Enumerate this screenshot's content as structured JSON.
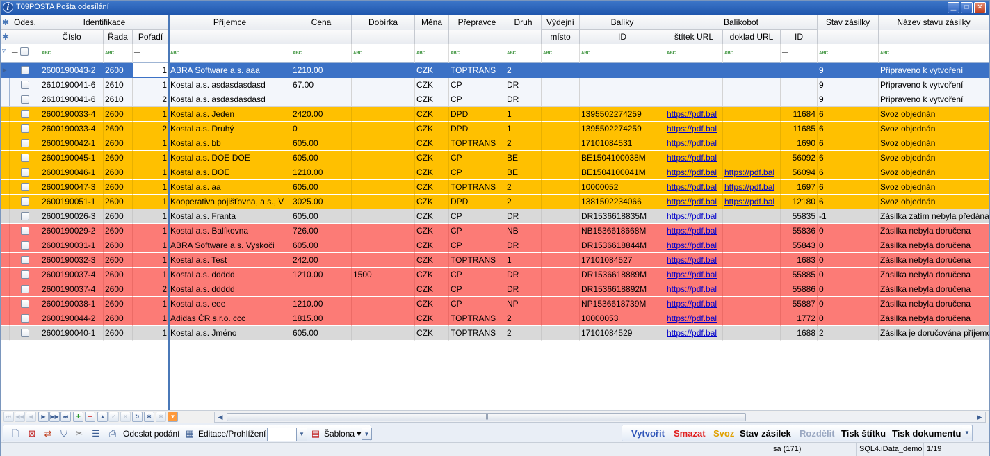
{
  "window": {
    "title": "T09POSTA Pošta odesílání"
  },
  "header": {
    "top": {
      "ods": "Odes.",
      "identifikace": "Identifikace",
      "prijemce": "Příjemce",
      "cena": "Cena",
      "dobirka": "Dobírka",
      "mena": "Měna",
      "prepravce": "Přepravce",
      "druh": "Druh",
      "vydejni": "Výdejní",
      "baliky": "Balíky",
      "balikobot": "Balíkobot",
      "stav": "Stav zásilky",
      "nazev": "Název stavu zásilky"
    },
    "sub": {
      "cislo": "Číslo",
      "rada": "Řada",
      "poradi": "Pořadí",
      "misto": "místo",
      "id": "ID",
      "stitek": "štítek URL",
      "doklad": "doklad URL",
      "bid": "ID"
    }
  },
  "colors": {
    "selected": "#3c72c6",
    "orange": "#ffc000",
    "red": "#fc7b76",
    "gray": "#d9d9d9",
    "white": "#f3f6fb"
  },
  "rows": [
    {
      "style": "sel",
      "cislo": "2600190043-2",
      "rada": "2600",
      "poradi": "1",
      "prijemce": "ABRA Software a.s.  aaa",
      "cena": "1210.00",
      "dobirka": "",
      "mena": "CZK",
      "prepravce": "TOPTRANS",
      "druh": "2",
      "misto": "",
      "id": "",
      "stitek": "",
      "doklad": "",
      "bid": "",
      "stav": "9",
      "nazev": "Připraveno k vytvoření"
    },
    {
      "style": "white",
      "cislo": "2610190041-6",
      "rada": "2610",
      "poradi": "1",
      "prijemce": "Kostal a.s.  asdasdasdasd",
      "cena": "67.00",
      "dobirka": "",
      "mena": "CZK",
      "prepravce": "CP",
      "druh": "DR",
      "misto": "",
      "id": "",
      "stitek": "",
      "doklad": "",
      "bid": "",
      "stav": "9",
      "nazev": "Připraveno k vytvoření"
    },
    {
      "style": "white",
      "cislo": "2610190041-6",
      "rada": "2610",
      "poradi": "2",
      "prijemce": "Kostal a.s.  asdasdasdasd",
      "cena": "",
      "dobirka": "",
      "mena": "CZK",
      "prepravce": "CP",
      "druh": "DR",
      "misto": "",
      "id": "",
      "stitek": "",
      "doklad": "",
      "bid": "",
      "stav": "9",
      "nazev": "Připraveno k vytvoření"
    },
    {
      "style": "orange",
      "cislo": "2600190033-4",
      "rada": "2600",
      "poradi": "1",
      "prijemce": "Kostal a.s.  Jeden",
      "cena": "2420.00",
      "dobirka": "",
      "mena": "CZK",
      "prepravce": "DPD",
      "druh": "1",
      "misto": "",
      "id": "1395502274259",
      "stitek": "https://pdf.bal",
      "doklad": "",
      "bid": "11684",
      "stav": "6",
      "nazev": "Svoz objednán"
    },
    {
      "style": "orange",
      "cislo": "2600190033-4",
      "rada": "2600",
      "poradi": "2",
      "prijemce": "Kostal a.s.  Druhý",
      "cena": "0",
      "dobirka": "",
      "mena": "CZK",
      "prepravce": "DPD",
      "druh": "1",
      "misto": "",
      "id": "1395502274259",
      "stitek": "https://pdf.bal",
      "doklad": "",
      "bid": "11685",
      "stav": "6",
      "nazev": "Svoz objednán"
    },
    {
      "style": "orange",
      "cislo": "2600190042-1",
      "rada": "2600",
      "poradi": "1",
      "prijemce": "Kostal a.s.  bb",
      "cena": "605.00",
      "dobirka": "",
      "mena": "CZK",
      "prepravce": "TOPTRANS",
      "druh": "2",
      "misto": "",
      "id": "17101084531",
      "stitek": "https://pdf.bal",
      "doklad": "",
      "bid": "1690",
      "stav": "6",
      "nazev": "Svoz objednán"
    },
    {
      "style": "orange",
      "cislo": "2600190045-1",
      "rada": "2600",
      "poradi": "1",
      "prijemce": "Kostal a.s.  DOE DOE",
      "cena": "605.00",
      "dobirka": "",
      "mena": "CZK",
      "prepravce": "CP",
      "druh": "BE",
      "misto": "",
      "id": "BE1504100038M",
      "stitek": "https://pdf.bal",
      "doklad": "",
      "bid": "56092",
      "stav": "6",
      "nazev": "Svoz objednán"
    },
    {
      "style": "orange",
      "cislo": "2600190046-1",
      "rada": "2600",
      "poradi": "1",
      "prijemce": "Kostal a.s.  DOE",
      "cena": "1210.00",
      "dobirka": "",
      "mena": "CZK",
      "prepravce": "CP",
      "druh": "BE",
      "misto": "",
      "id": "BE1504100041M",
      "stitek": "https://pdf.bal",
      "doklad": "https://pdf.bal",
      "bid": "56094",
      "stav": "6",
      "nazev": "Svoz objednán"
    },
    {
      "style": "orange",
      "cislo": "2600190047-3",
      "rada": "2600",
      "poradi": "1",
      "prijemce": "Kostal a.s.  aa",
      "cena": "605.00",
      "dobirka": "",
      "mena": "CZK",
      "prepravce": "TOPTRANS",
      "druh": "2",
      "misto": "",
      "id": "10000052",
      "stitek": "https://pdf.bal",
      "doklad": "https://pdf.bal",
      "bid": "1697",
      "stav": "6",
      "nazev": "Svoz objednán"
    },
    {
      "style": "orange",
      "cislo": "2600190051-1",
      "rada": "2600",
      "poradi": "1",
      "prijemce": "Kooperativa pojišťovna, a.s., V",
      "cena": "3025.00",
      "dobirka": "",
      "mena": "CZK",
      "prepravce": "DPD",
      "druh": "2",
      "misto": "",
      "id": "1381502234066",
      "stitek": "https://pdf.bal",
      "doklad": "https://pdf.bal",
      "bid": "12180",
      "stav": "6",
      "nazev": "Svoz objednán"
    },
    {
      "style": "gray",
      "cislo": "2600190026-3",
      "rada": "2600",
      "poradi": "1",
      "prijemce": "Kostal a.s.  Franta",
      "cena": "605.00",
      "dobirka": "",
      "mena": "CZK",
      "prepravce": "CP",
      "druh": "DR",
      "misto": "",
      "id": "DR1536618835M",
      "stitek": "https://pdf.bal",
      "doklad": "",
      "bid": "55835",
      "stav": "-1",
      "nazev": "Zásilka zatím nebyla předána"
    },
    {
      "style": "red",
      "cislo": "2600190029-2",
      "rada": "2600",
      "poradi": "1",
      "prijemce": "Kostal a.s.  Balíkovna",
      "cena": "726.00",
      "dobirka": "",
      "mena": "CZK",
      "prepravce": "CP",
      "druh": "NB",
      "misto": "",
      "id": "NB1536618668M",
      "stitek": "https://pdf.bal",
      "doklad": "",
      "bid": "55836",
      "stav": "0",
      "nazev": "Zásilka nebyla doručena"
    },
    {
      "style": "red",
      "cislo": "2600190031-1",
      "rada": "2600",
      "poradi": "1",
      "prijemce": "ABRA Software a.s.  Vyskoči",
      "cena": "605.00",
      "dobirka": "",
      "mena": "CZK",
      "prepravce": "CP",
      "druh": "DR",
      "misto": "",
      "id": "DR1536618844M",
      "stitek": "https://pdf.bal",
      "doklad": "",
      "bid": "55843",
      "stav": "0",
      "nazev": "Zásilka nebyla doručena"
    },
    {
      "style": "red",
      "cislo": "2600190032-3",
      "rada": "2600",
      "poradi": "1",
      "prijemce": "Kostal a.s.  Test",
      "cena": "242.00",
      "dobirka": "",
      "mena": "CZK",
      "prepravce": "TOPTRANS",
      "druh": "1",
      "misto": "",
      "id": "17101084527",
      "stitek": "https://pdf.bal",
      "doklad": "",
      "bid": "1683",
      "stav": "0",
      "nazev": "Zásilka nebyla doručena"
    },
    {
      "style": "red",
      "cislo": "2600190037-4",
      "rada": "2600",
      "poradi": "1",
      "prijemce": "Kostal a.s.  ddddd",
      "cena": "1210.00",
      "dobirka": "1500",
      "mena": "CZK",
      "prepravce": "CP",
      "druh": "DR",
      "misto": "",
      "id": "DR1536618889M",
      "stitek": "https://pdf.bal",
      "doklad": "",
      "bid": "55885",
      "stav": "0",
      "nazev": "Zásilka nebyla doručena"
    },
    {
      "style": "red",
      "cislo": "2600190037-4",
      "rada": "2600",
      "poradi": "2",
      "prijemce": "Kostal a.s.  ddddd",
      "cena": "",
      "dobirka": "",
      "mena": "CZK",
      "prepravce": "CP",
      "druh": "DR",
      "misto": "",
      "id": "DR1536618892M",
      "stitek": "https://pdf.bal",
      "doklad": "",
      "bid": "55886",
      "stav": "0",
      "nazev": "Zásilka nebyla doručena"
    },
    {
      "style": "red",
      "cislo": "2600190038-1",
      "rada": "2600",
      "poradi": "1",
      "prijemce": "Kostal a.s.  eee",
      "cena": "1210.00",
      "dobirka": "",
      "mena": "CZK",
      "prepravce": "CP",
      "druh": "NP",
      "misto": "",
      "id": "NP1536618739M",
      "stitek": "https://pdf.bal",
      "doklad": "",
      "bid": "55887",
      "stav": "0",
      "nazev": "Zásilka nebyla doručena"
    },
    {
      "style": "red",
      "cislo": "2600190044-2",
      "rada": "2600",
      "poradi": "1",
      "prijemce": "Adidas ČR s.r.o.  ccc",
      "cena": "1815.00",
      "dobirka": "",
      "mena": "CZK",
      "prepravce": "TOPTRANS",
      "druh": "2",
      "misto": "",
      "id": "10000053",
      "stitek": "https://pdf.bal",
      "doklad": "",
      "bid": "1772",
      "stav": "0",
      "nazev": "Zásilka nebyla doručena"
    },
    {
      "style": "gray",
      "cislo": "2600190040-1",
      "rada": "2600",
      "poradi": "1",
      "prijemce": "Kostal a.s.  Jméno",
      "cena": "605.00",
      "dobirka": "",
      "mena": "CZK",
      "prepravce": "TOPTRANS",
      "druh": "2",
      "misto": "",
      "id": "17101084529",
      "stitek": "https://pdf.bal",
      "doklad": "",
      "bid": "1688",
      "stav": "2",
      "nazev": "Zásilka je doručována příjemci"
    }
  ],
  "toolbar": {
    "odeslat": "Odeslat podání",
    "editace": "Editace/Prohlížení",
    "sablona": "Šablona"
  },
  "actions": {
    "vytvorit": "Vytvořit",
    "smazat": "Smazat",
    "svoz": "Svoz",
    "stav": "Stav zásilek",
    "rozdelit": "Rozdělit",
    "tisk_stitku": "Tisk štítku",
    "tisk_dokumentu": "Tisk dokumentu"
  },
  "action_colors": {
    "vytvorit": "#2f55b8",
    "smazat": "#e02020",
    "svoz": "#e0a000",
    "stav": "#000000",
    "rozdelit": "#9aa8c2",
    "tisk_stitku": "#000000",
    "tisk_dokumentu": "#000000"
  },
  "status": {
    "user": "sa (171)",
    "db": "SQL4.iData_demo",
    "pos": "1/19"
  }
}
